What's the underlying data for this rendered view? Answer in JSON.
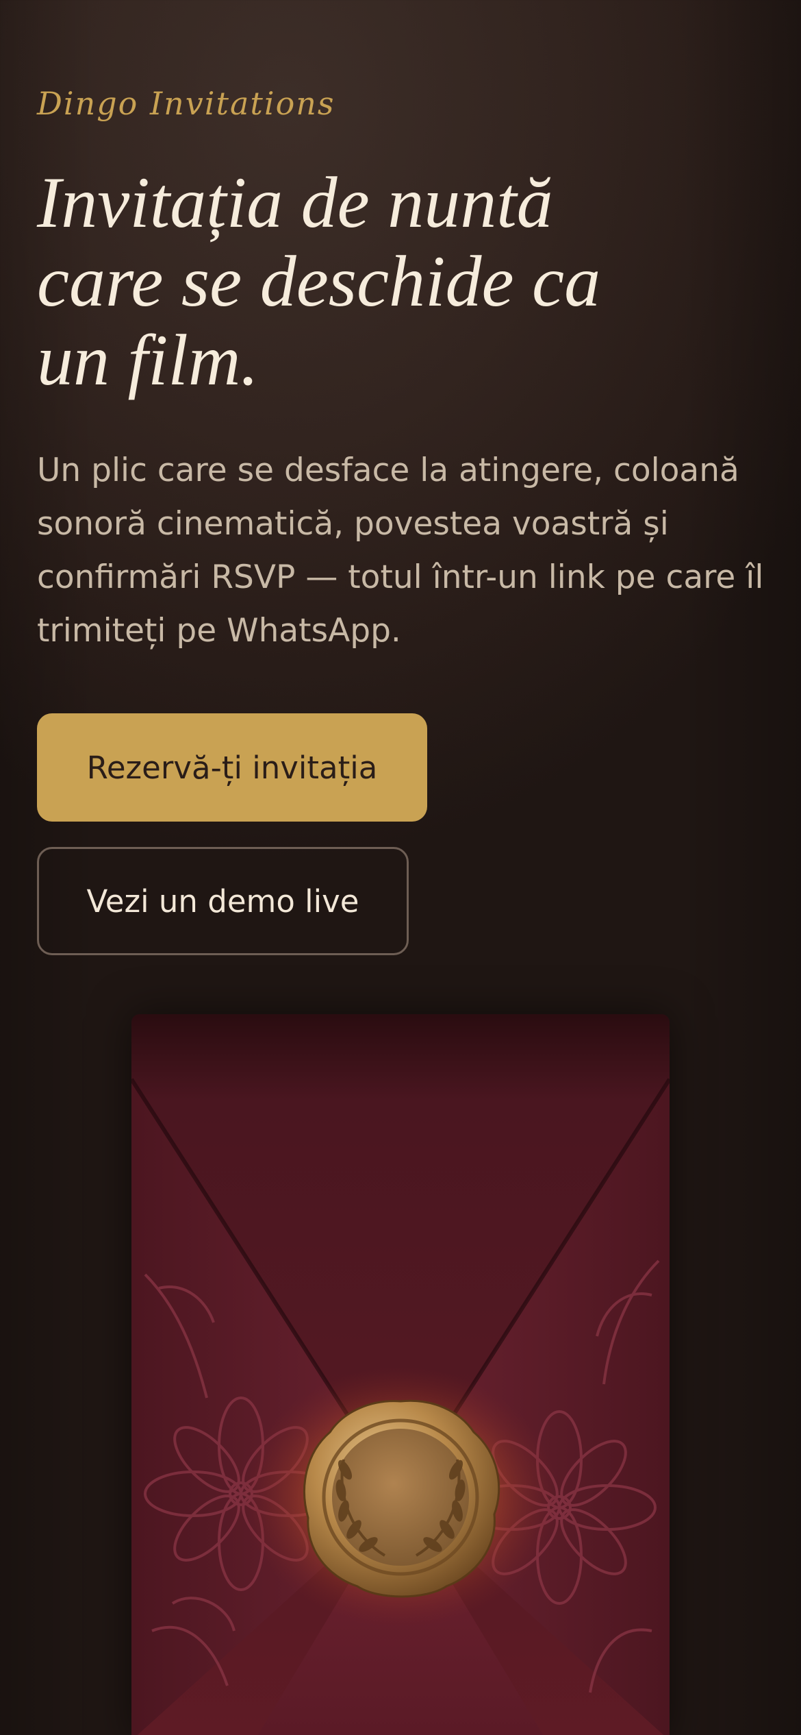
{
  "brand": {
    "name": "Dingo Invitations"
  },
  "hero": {
    "title_lines": [
      "Invitația de nuntă",
      "care se deschide ca",
      "un film."
    ],
    "description_lines": [
      "Un plic care se desface la atingere, coloană",
      "sonoră cinematică, povestea voastră și",
      "confirmări RSVP — totul într-un link pe care îl",
      "trimiteți pe WhatsApp."
    ]
  },
  "actions": {
    "primary_label": "Rezervă-ți invitația",
    "secondary_label": "Vezi un demo live"
  },
  "colors": {
    "accent_gold": "#c9a253",
    "background": "#32241f",
    "title_text": "#f6ecdc",
    "body_text": "#c8b9a6",
    "envelope_burgundy": "#6b1f2a",
    "wax_seal_gold": "#b8894a"
  },
  "envelope_image": {
    "icons": [
      "wax-seal-icon",
      "laurel-wreath-icon",
      "floral-embossing"
    ]
  }
}
